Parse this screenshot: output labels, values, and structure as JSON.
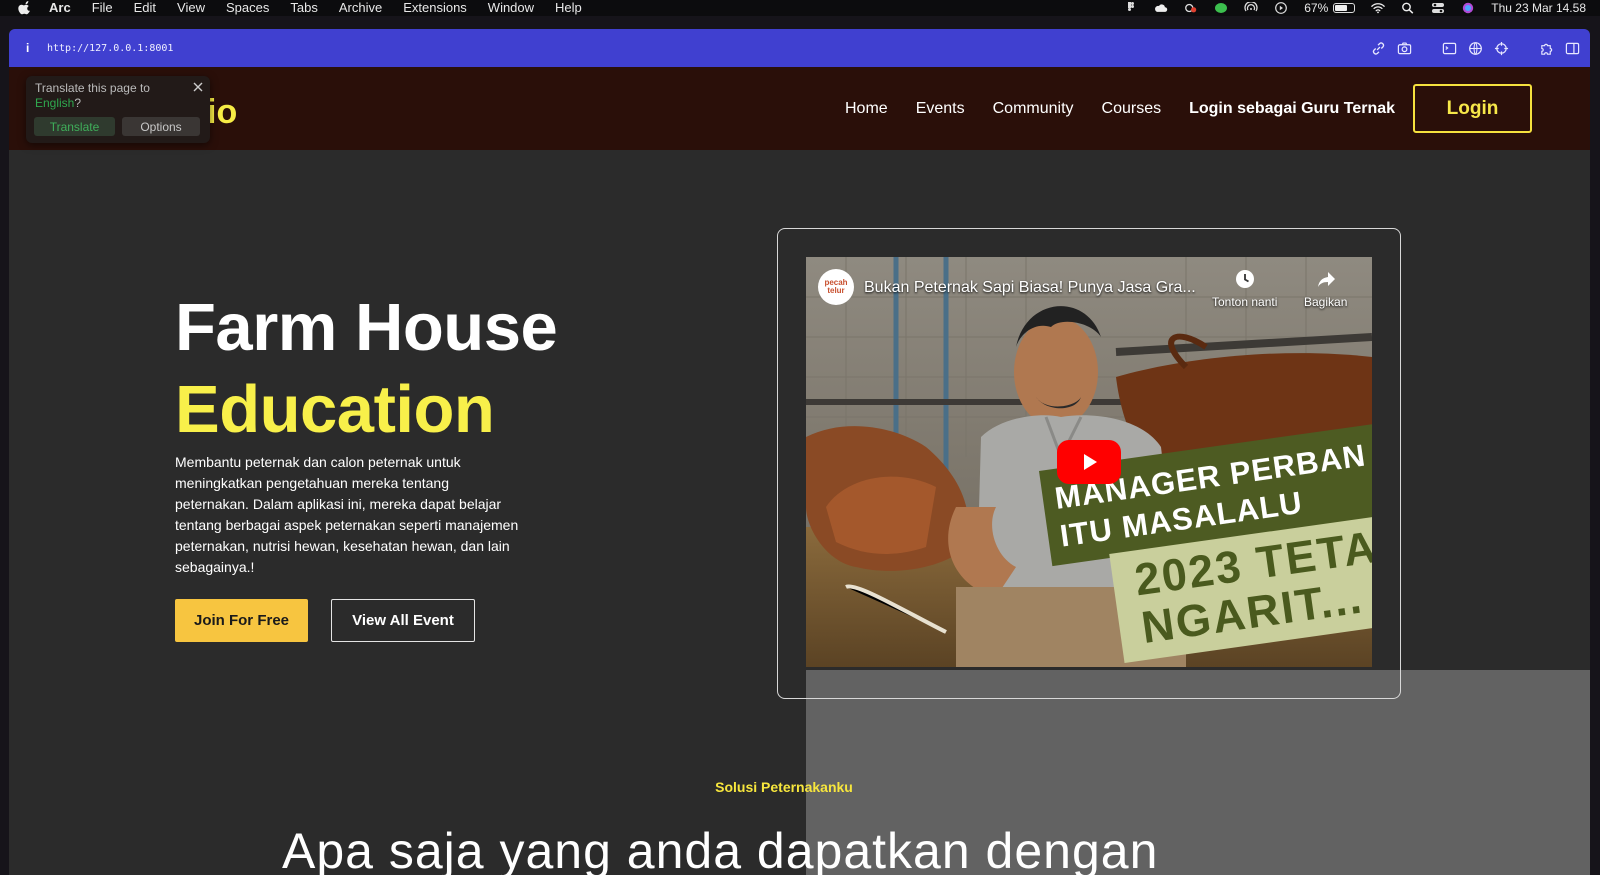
{
  "menubar": {
    "app_name": "Arc",
    "menus": [
      "File",
      "Edit",
      "View",
      "Spaces",
      "Tabs",
      "Archive",
      "Extensions",
      "Window",
      "Help"
    ],
    "battery_percent": "67%",
    "battery_level": 0.67,
    "datetime": "Thu 23 Mar  14.58",
    "status_icons": [
      "figma-icon",
      "cloud-icon",
      "creative-cloud-icon",
      "line-icon",
      "airdrop-icon",
      "play-icon",
      "battery-icon",
      "wifi-icon",
      "search-icon",
      "control-center-icon",
      "siri-icon"
    ]
  },
  "browser": {
    "url": "http://127.0.0.1:8001",
    "info_glyph": "i",
    "toolbar_icons": [
      "link-icon",
      "camera-icon",
      "window-icon",
      "globe-icon",
      "target-icon",
      "extensions-icon",
      "sidebar-icon"
    ]
  },
  "translate_popup": {
    "message": "Translate this page to",
    "language": "English",
    "suffix": "?",
    "translate_label": "Translate",
    "options_label": "Options"
  },
  "site_nav": {
    "logo_fragment": "io",
    "links": [
      "Home",
      "Events",
      "Community",
      "Courses"
    ],
    "guru_login": "Login sebagai Guru Ternak",
    "login_label": "Login"
  },
  "hero": {
    "title_line1": "Farm House",
    "title_line2": "Education",
    "description": "Membantu peternak dan calon peternak untuk meningkatkan pengetahuan mereka tentang peternakan. Dalam aplikasi ini, mereka dapat belajar tentang berbagai aspek peternakan seperti manajemen peternakan, nutrisi hewan, kesehatan hewan, dan lain sebagainya.!",
    "join_label": "Join For Free",
    "view_events_label": "View All Event"
  },
  "video": {
    "channel_logo": "pecah telur",
    "title": "Bukan Peternak Sapi Biasa! Punya Jasa Gra...",
    "watch_later": "Tonton nanti",
    "share": "Bagikan",
    "thumb_text_line1": "MANAGER PERBAN",
    "thumb_text_line2": "ITU MASALALU",
    "thumb_text_line3": "2023 TETA",
    "thumb_text_line4": "NGARIT..."
  },
  "section": {
    "eyebrow": "Solusi Peternakanku",
    "heading": "Apa saja yang anda dapatkan dengan"
  },
  "colors": {
    "accent_yellow": "#f8f04a",
    "button_yellow": "#f7c540",
    "nav_background": "#2a0f09",
    "page_background": "#2b2b2b",
    "urlbar": "#4040d0"
  }
}
